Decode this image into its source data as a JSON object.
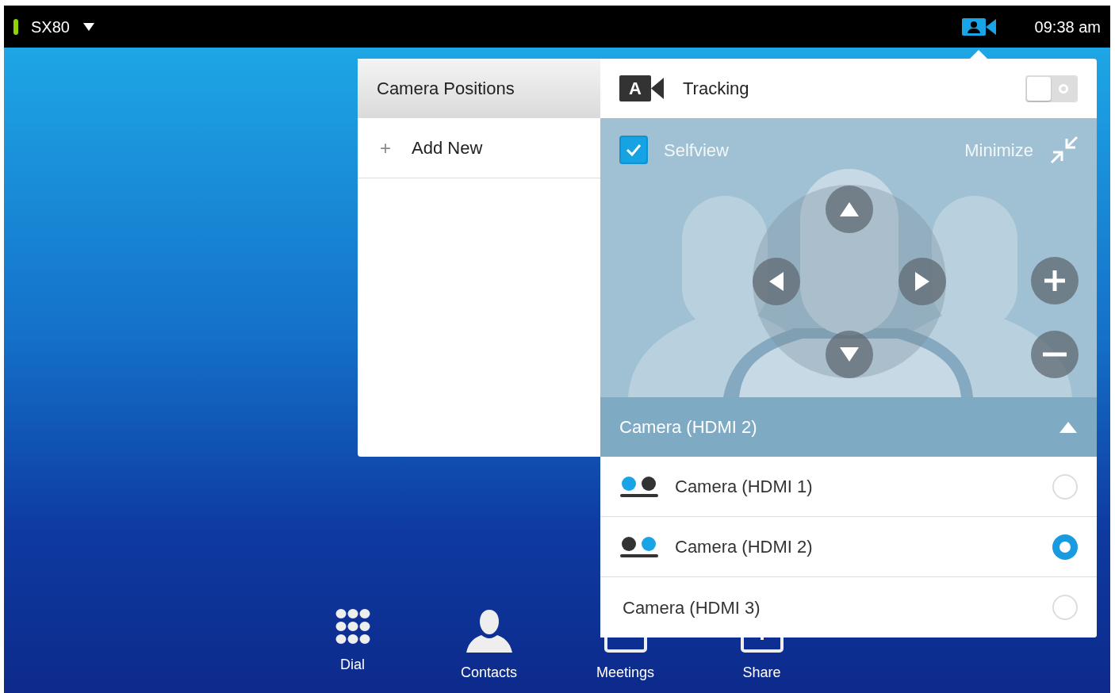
{
  "status_bar": {
    "device": "SX80",
    "time": "09:38 am",
    "camera_button": {
      "selected": true
    }
  },
  "camera_positions": {
    "title": "Camera Positions",
    "add_icon": "+",
    "add_label": "Add New"
  },
  "camera_control": {
    "tracking": {
      "badge": "A",
      "label": "Tracking",
      "on": false
    },
    "selfview": {
      "label": "Selfview",
      "checked": true
    },
    "minimize": "Minimize",
    "source": {
      "label": "Camera (HDMI 2)",
      "expanded": true
    },
    "sources": [
      {
        "label": "Camera (HDMI 1)",
        "kind": "camera_left",
        "selected": false
      },
      {
        "label": "Camera (HDMI 2)",
        "kind": "camera_right",
        "selected": true
      },
      {
        "label": "Camera (HDMI 3)",
        "kind": "plain",
        "selected": false
      }
    ]
  },
  "dock": [
    {
      "label": "Dial",
      "kind": "dial"
    },
    {
      "label": "Contacts",
      "kind": "contacts"
    },
    {
      "label": "Meetings",
      "kind": "meetings"
    },
    {
      "label": "Share",
      "kind": "share"
    }
  ]
}
